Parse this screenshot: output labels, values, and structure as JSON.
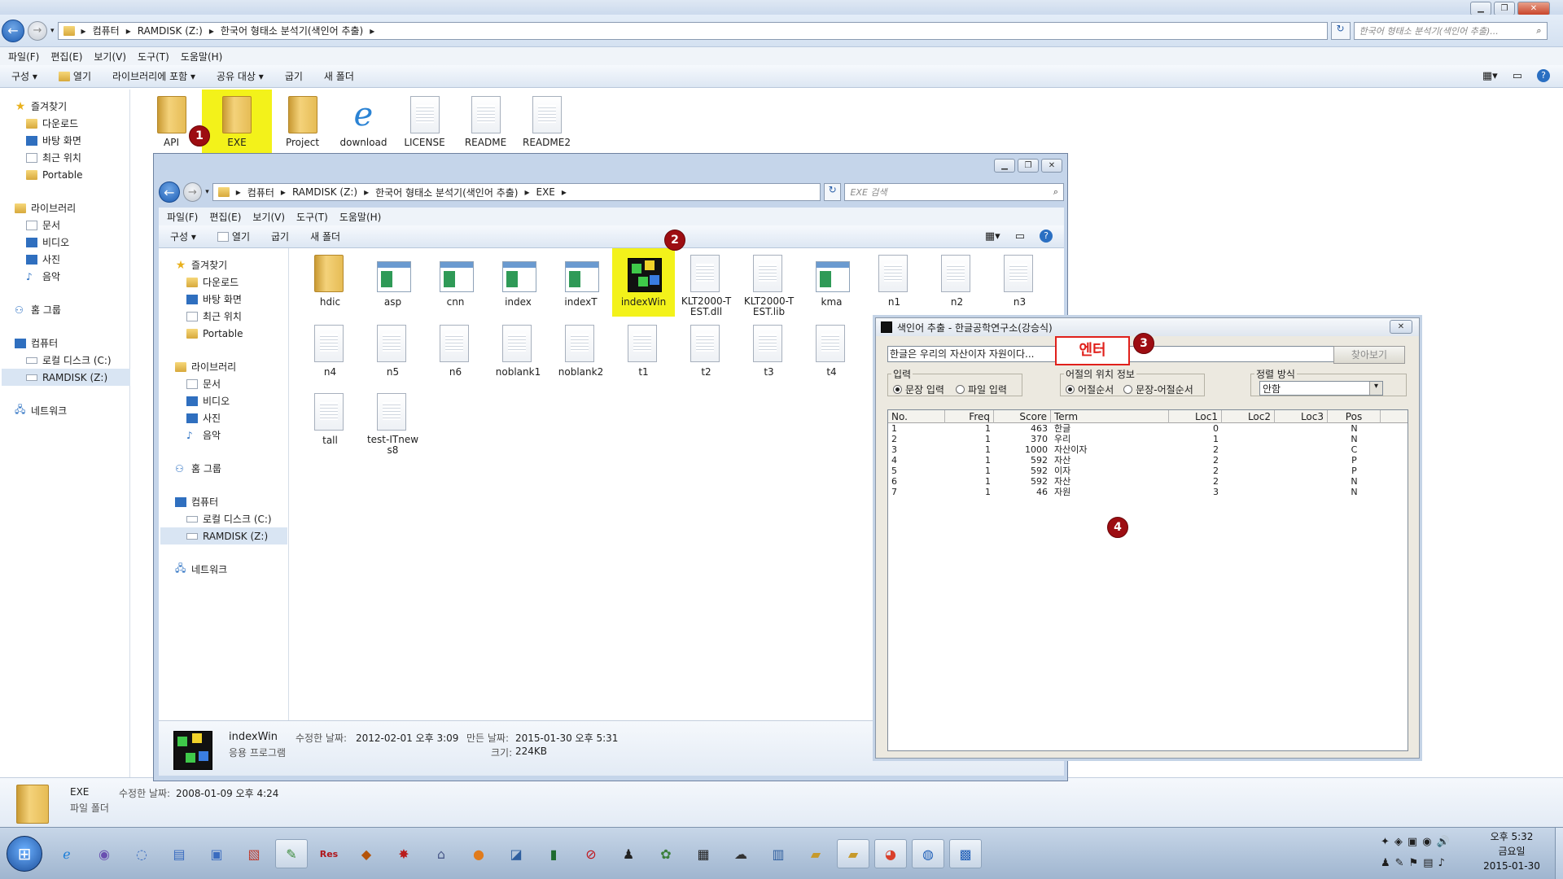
{
  "outer": {
    "breadcrumb": [
      "컴퓨터",
      "RAMDISK (Z:)",
      "한국어 형태소 분석기(색인어 추출)"
    ],
    "search_placeholder": "한국어 형태소 분석기(색인어 추출)...",
    "menu": [
      "파일(F)",
      "편집(E)",
      "보기(V)",
      "도구(T)",
      "도움말(H)"
    ],
    "commands": [
      "구성 ▾",
      "열기",
      "라이브러리에 포함 ▾",
      "공유 대상 ▾",
      "굽기",
      "새 폴더"
    ],
    "nav": {
      "favorites": "즐겨찾기",
      "fav_items": [
        "다운로드",
        "바탕 화면",
        "최근 위치",
        "Portable"
      ],
      "libraries": "라이브러리",
      "lib_items": [
        "문서",
        "비디오",
        "사진",
        "음악"
      ],
      "homegroup": "홈 그룹",
      "computer": "컴퓨터",
      "comp_items": [
        "로컬 디스크 (C:)",
        "RAMDISK (Z:)"
      ],
      "network": "네트워크"
    },
    "files": [
      "API",
      "EXE",
      "Project",
      "download",
      "LICENSE",
      "README",
      "README2"
    ],
    "details": {
      "name": "EXE",
      "modified_label": "수정한 날짜:",
      "modified": "2008-01-09 오후 4:24",
      "type": "파일 폴더"
    }
  },
  "inner": {
    "breadcrumb": [
      "컴퓨터",
      "RAMDISK (Z:)",
      "한국어 형태소 분석기(색인어 추출)",
      "EXE"
    ],
    "search_placeholder": "EXE 검색",
    "menu": [
      "파일(F)",
      "편집(E)",
      "보기(V)",
      "도구(T)",
      "도움말(H)"
    ],
    "commands": [
      "구성 ▾",
      "열기",
      "굽기",
      "새 폴더"
    ],
    "nav": {
      "favorites": "즐겨찾기",
      "fav_items": [
        "다운로드",
        "바탕 화면",
        "최근 위치",
        "Portable"
      ],
      "libraries": "라이브러리",
      "lib_items": [
        "문서",
        "비디오",
        "사진",
        "음악"
      ],
      "homegroup": "홈 그룹",
      "computer": "컴퓨터",
      "comp_items": [
        "로컬 디스크 (C:)",
        "RAMDISK (Z:)"
      ],
      "network": "네트워크"
    },
    "files_row1": [
      "hdic",
      "asp",
      "cnn",
      "index",
      "indexT",
      "indexWin",
      "KLT2000-TEST.dll",
      "KLT2000-TEST.lib",
      "kma",
      "n1",
      "n2",
      "n3"
    ],
    "files_row2": [
      "n4",
      "n5",
      "n6",
      "noblank1",
      "noblank2",
      "t1",
      "t2",
      "t3",
      "t4"
    ],
    "files_row3": [
      "tall",
      "test-ITnews8"
    ],
    "details": {
      "name": "indexWin",
      "type": "응용 프로그램",
      "modified_label": "수정한 날짜:",
      "modified": "2012-02-01 오후 3:09",
      "created_label": "만든 날짜:",
      "created": "2015-01-30 오후 5:31",
      "size_label": "크기:",
      "size": "224KB"
    }
  },
  "dialog": {
    "title": "색인어 추출 - 한글공학연구소(강승식)",
    "input_value": "한글은 우리의 자산이자 자원이다...",
    "enter_label": "엔터",
    "browse_button": "찾아보기",
    "input_group": "입력",
    "input_options": [
      "문장 입력",
      "파일 입력"
    ],
    "position_group": "어절의 위치 정보",
    "position_options": [
      "어절순서",
      "문장-어절순서"
    ],
    "sort_group": "정렬 방식",
    "sort_value": "안함",
    "columns": [
      "No.",
      "Freq",
      "Score",
      "Term",
      "Loc1",
      "Loc2",
      "Loc3",
      "Pos"
    ],
    "rows": [
      [
        "1",
        "1",
        "463",
        "한글",
        "0",
        "",
        "",
        "N"
      ],
      [
        "2",
        "1",
        "370",
        "우리",
        "1",
        "",
        "",
        "N"
      ],
      [
        "3",
        "1",
        "1000",
        "자산이자",
        "2",
        "",
        "",
        "C"
      ],
      [
        "4",
        "1",
        "592",
        "자산",
        "2",
        "",
        "",
        "P"
      ],
      [
        "5",
        "1",
        "592",
        "이자",
        "2",
        "",
        "",
        "P"
      ],
      [
        "6",
        "1",
        "592",
        "자산",
        "2",
        "",
        "",
        "N"
      ],
      [
        "7",
        "1",
        "46",
        "자원",
        "3",
        "",
        "",
        "N"
      ]
    ]
  },
  "annotations": [
    "1",
    "2",
    "3",
    "4"
  ],
  "taskbar": {
    "time": "오후 5:32",
    "day": "금요일",
    "date": "2015-01-30"
  },
  "colors": {
    "highlight": "#f3f21a",
    "badge": "#9d0d12",
    "enter_border": "#e0201b"
  }
}
